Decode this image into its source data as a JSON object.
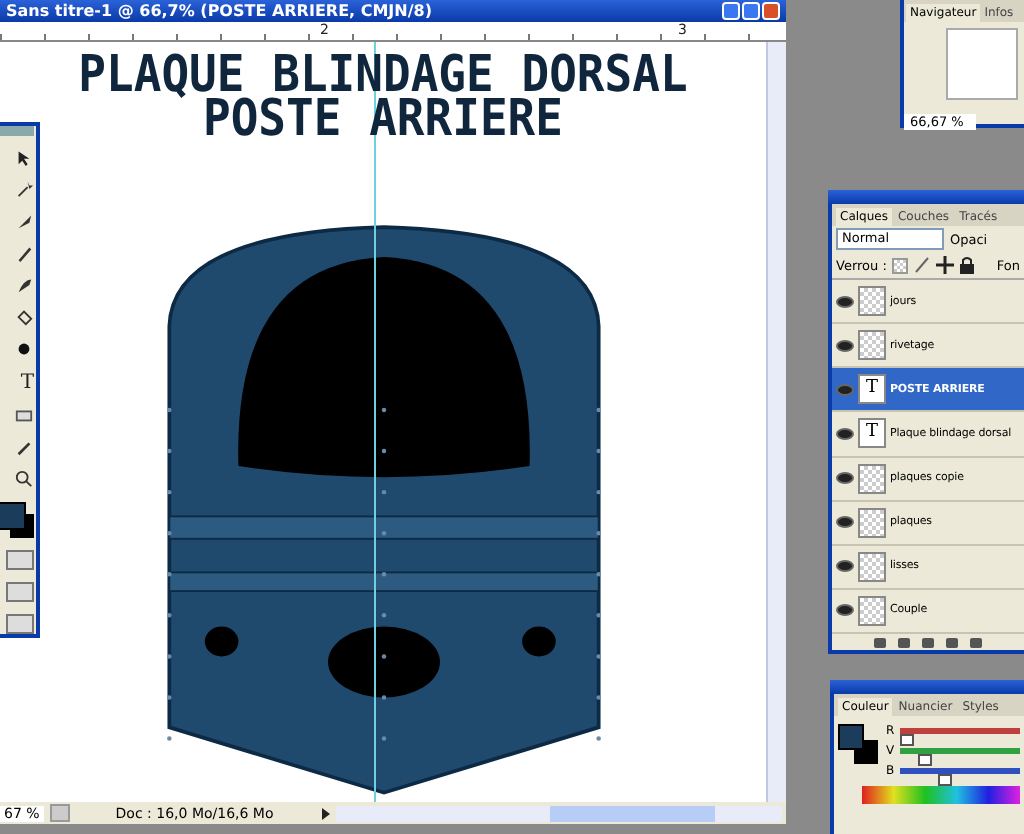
{
  "document": {
    "title": "Sans titre-1 @ 66,7% (POSTE ARRIERE, CMJN/8)",
    "ruler_marks": [
      "2",
      "3"
    ],
    "heading_lines": [
      "PLAQUE BLINDAGE DORSAL",
      "POSTE ARRIERE"
    ],
    "zoom": "67 %",
    "doc_info": "Doc : 16,0 Mo/16,6 Mo"
  },
  "toolbox": {
    "tools": [
      {
        "kind": "move"
      },
      {
        "kind": "wand"
      },
      {
        "kind": "slice"
      },
      {
        "kind": "brush"
      },
      {
        "kind": "history"
      },
      {
        "kind": "bucket"
      },
      {
        "kind": "burn"
      },
      {
        "kind": "text",
        "glyph": "T"
      },
      {
        "kind": "shape"
      },
      {
        "kind": "eyedropper"
      },
      {
        "kind": "zoom"
      }
    ]
  },
  "navigator": {
    "tabs": [
      {
        "label": "Navigateur",
        "selected": true
      },
      {
        "label": "Infos",
        "selected": false
      }
    ],
    "zoom": "66,67 %"
  },
  "layers_panel": {
    "tabs": [
      {
        "label": "Calques",
        "selected": true
      },
      {
        "label": "Couches",
        "selected": false
      },
      {
        "label": "Tracés",
        "selected": false
      }
    ],
    "blend_mode": "Normal",
    "opacity_label": "Opaci",
    "lock_label": "Verrou :",
    "fill_label": "Fon",
    "layers": [
      {
        "name": "jours",
        "kind": "pixel",
        "selected": false,
        "visible": true
      },
      {
        "name": "rivetage",
        "kind": "pixel",
        "selected": false,
        "visible": true
      },
      {
        "name": "POSTE ARRIERE",
        "kind": "text",
        "glyph": "T",
        "selected": true,
        "visible": true
      },
      {
        "name": "Plaque blindage dorsal",
        "kind": "text",
        "glyph": "T",
        "selected": false,
        "visible": true
      },
      {
        "name": "plaques copie",
        "kind": "pixel",
        "selected": false,
        "visible": true
      },
      {
        "name": "plaques",
        "kind": "pixel",
        "selected": false,
        "visible": true
      },
      {
        "name": "lisses",
        "kind": "pixel",
        "selected": false,
        "visible": true
      },
      {
        "name": "Couple",
        "kind": "pixel",
        "selected": false,
        "visible": true
      }
    ]
  },
  "color_panel": {
    "tabs": [
      {
        "label": "Couleur",
        "selected": true
      },
      {
        "label": "Nuancier",
        "selected": false
      },
      {
        "label": "Styles",
        "selected": false
      }
    ],
    "sliders": [
      {
        "label": "R",
        "level": 0.05,
        "color": "#c04040"
      },
      {
        "label": "V",
        "level": 0.2,
        "color": "#30a040"
      },
      {
        "label": "B",
        "level": 0.36,
        "color": "#3050c0"
      }
    ]
  }
}
